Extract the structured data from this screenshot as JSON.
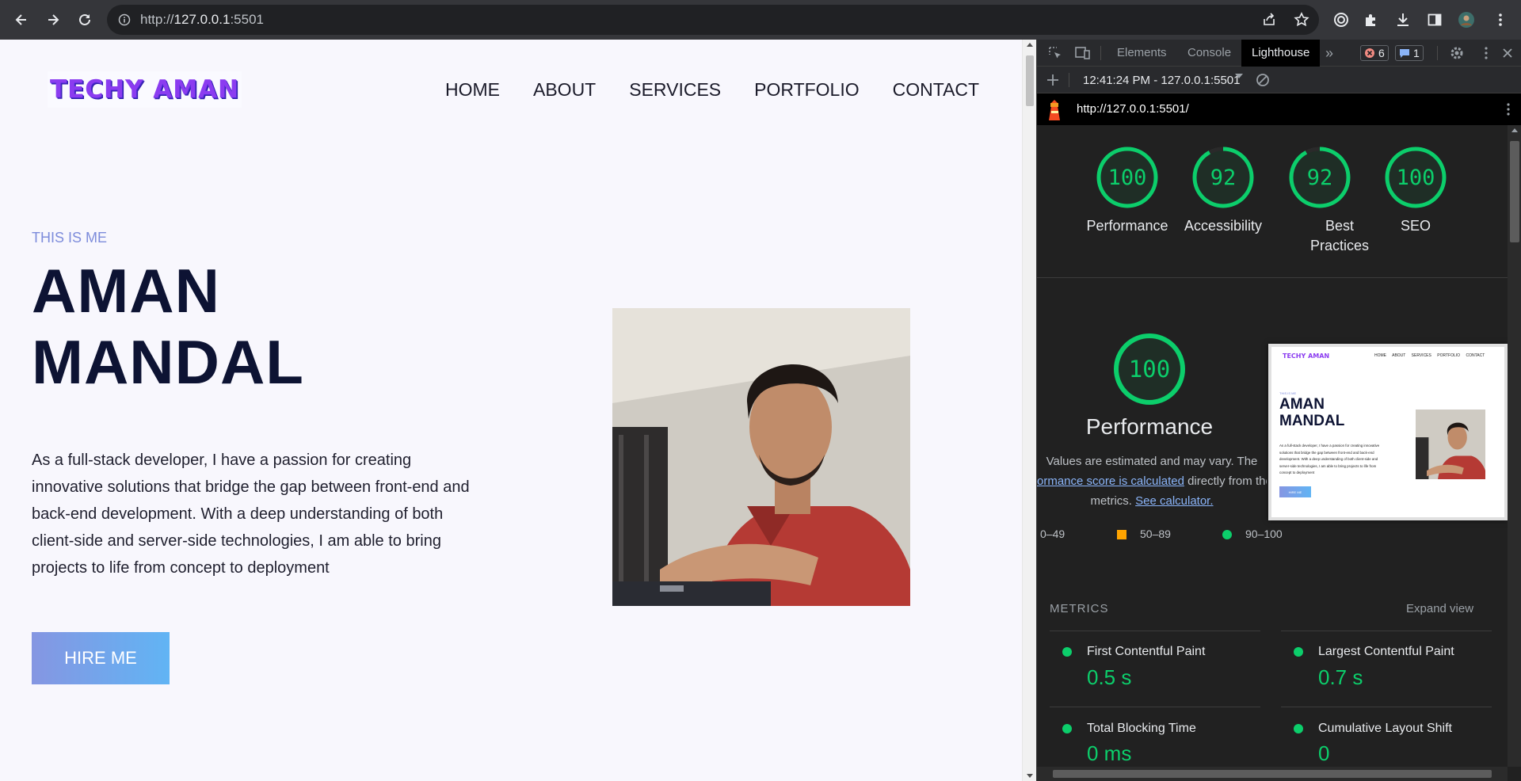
{
  "browser": {
    "url_scheme": "http://",
    "url_host": "127.0.0.1",
    "url_port": ":5501"
  },
  "site": {
    "logo_text": "TECHY AMAN",
    "nav": [
      "HOME",
      "ABOUT",
      "SERVICES",
      "PORTFOLIO",
      "CONTACT"
    ],
    "eyebrow": "THIS IS ME",
    "name_line1": "AMAN",
    "name_line2": "MANDAL",
    "description": "As a full-stack developer, I have a passion for creating innovative solutions that bridge the gap between front-end and back-end development. With a deep understanding of both client-side and server-side technologies, I am able to bring projects to life from concept to deployment",
    "hire_button": "HIRE ME"
  },
  "devtools": {
    "tabs": [
      "Elements",
      "Console",
      "Lighthouse"
    ],
    "active_tab": "Lighthouse",
    "error_count": "6",
    "message_count": "1",
    "report_selector": "12:41:24 PM - 127.0.0.1:5501",
    "report_url": "http://127.0.0.1:5501/",
    "scores": [
      {
        "value": "100",
        "label": "Performance"
      },
      {
        "value": "92",
        "label": "Accessibility"
      },
      {
        "value": "92",
        "label": "Best Practices"
      },
      {
        "value": "100",
        "label": "SEO"
      }
    ],
    "main_score": "100",
    "main_title": "Performance",
    "explain_line1": "Values are estimated and may vary. The",
    "explain_link1": "ormance score is calculated",
    "explain_after_link1": "directly from the",
    "explain_line3_pre": "metrics.",
    "explain_link2": "See calculator.",
    "legend": [
      {
        "range": "0–49",
        "color": "#ff4e42"
      },
      {
        "range": "50–89",
        "color": "#ffa400"
      },
      {
        "range": "90–100",
        "color": "#0cce6b"
      }
    ],
    "metrics_heading": "METRICS",
    "expand_view": "Expand view",
    "metrics": [
      {
        "name": "First Contentful Paint",
        "value": "0.5 s"
      },
      {
        "name": "Largest Contentful Paint",
        "value": "0.7 s"
      },
      {
        "name": "Total Blocking Time",
        "value": "0 ms"
      },
      {
        "name": "Cumulative Layout Shift",
        "value": "0"
      }
    ],
    "colors": {
      "pass": "#0cce6b",
      "link": "#8ab4f8"
    }
  }
}
